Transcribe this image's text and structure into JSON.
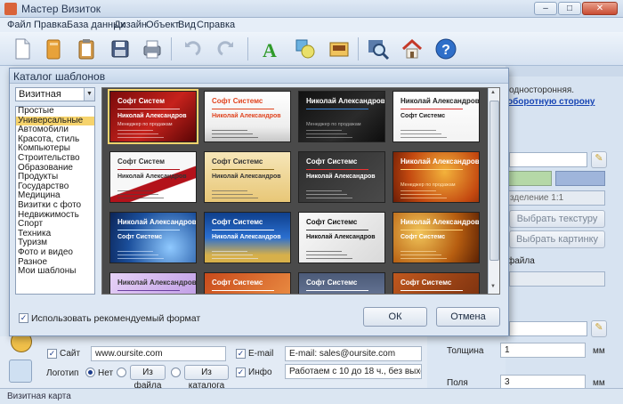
{
  "window": {
    "title": "Мастер Визиток",
    "min": "–",
    "max": "□",
    "close": "✕"
  },
  "menu": [
    "Файл",
    "Правка",
    "База данных",
    "Дизайн",
    "Объект",
    "Вид",
    "Справка"
  ],
  "toolbar": {
    "icons": [
      "new-file-icon",
      "open-folder-icon",
      "clipboard-icon",
      "save-icon",
      "print-icon",
      "undo-icon",
      "redo-icon",
      "text-icon",
      "shapes-icon",
      "image-icon",
      "zoom-icon",
      "home-icon",
      "help-icon"
    ]
  },
  "right_panel": {
    "text1": "односторонняя.",
    "link": "оборотную сторону",
    "division": "зделение 1:1",
    "choose_texture": "Выбрать текстуру",
    "choose_picture": "Выбрать картинку",
    "file_label": "файла",
    "thickness_label": "Толщина",
    "thickness_value": "1",
    "thickness_unit": "мм",
    "margins_label": "Поля",
    "margins_value": "3",
    "margins_unit": "мм",
    "colors": {
      "green": "#b5d8a7",
      "blue": "#9fb5db"
    }
  },
  "bottom": {
    "site_label": "Сайт",
    "site_value": "www.oursite.com",
    "email_label": "E-mail",
    "email_value": "E-mail: sales@oursite.com",
    "logo_label": "Логотип",
    "no_label": "Нет",
    "from_file": "Из файла",
    "from_catalog": "Из каталога",
    "info_label": "Инфо",
    "info_value": "Работаем с 10 до 18 ч., без выходных"
  },
  "dialog": {
    "title": "Каталог шаблонов",
    "type_selected": "Визитная",
    "categories": [
      "Простые",
      "Универсальные",
      "Автомобили",
      "Красота, стиль",
      "Компьютеры",
      "Строительство",
      "Образование",
      "Продукты",
      "Государство",
      "Медицина",
      "Визитки с фото",
      "Недвижимость",
      "Спорт",
      "Техника",
      "Туризм",
      "Фото и видео",
      "Разное",
      "Мои шаблоны"
    ],
    "selected_category": "Универсальные",
    "use_recommended": "Использовать рекомендуемый формат",
    "ok": "ОК",
    "cancel": "Отмена",
    "cards": [
      {
        "title": "Софт Систем",
        "name": "Николай Александров",
        "sub": "Менеджер по продажам"
      },
      {
        "title": "Софт Системс",
        "name": "Николай Александров",
        "sub": ""
      },
      {
        "title": "Николай Александров",
        "name": "",
        "sub": "Менеджер по продажам"
      },
      {
        "title": "Николай Александров",
        "name": "Софт Системс",
        "sub": ""
      },
      {
        "title": "Софт Систем",
        "name": "Николай Александров",
        "sub": ""
      },
      {
        "title": "Софт Системс",
        "name": "Николай Александров",
        "sub": ""
      },
      {
        "title": "Софт Системс",
        "name": "Николай Александров",
        "sub": ""
      },
      {
        "title": "Николай Александров",
        "name": "",
        "sub": "Менеджер по продажам"
      },
      {
        "title": "Николай Александров",
        "name": "Софт Системс",
        "sub": ""
      },
      {
        "title": "Софт Системс",
        "name": "Николай Александров",
        "sub": ""
      },
      {
        "title": "Софт Системс",
        "name": "Николай Александров",
        "sub": ""
      },
      {
        "title": "Николай Александров",
        "name": "Софт Системс",
        "sub": ""
      },
      {
        "title": "Николай Александров",
        "name": "",
        "sub": ""
      },
      {
        "title": "Софт Системс",
        "name": "",
        "sub": ""
      },
      {
        "title": "Софт Системс",
        "name": "",
        "sub": ""
      },
      {
        "title": "Софт Системс",
        "name": "",
        "sub": ""
      }
    ]
  },
  "status": "Визитная карта"
}
